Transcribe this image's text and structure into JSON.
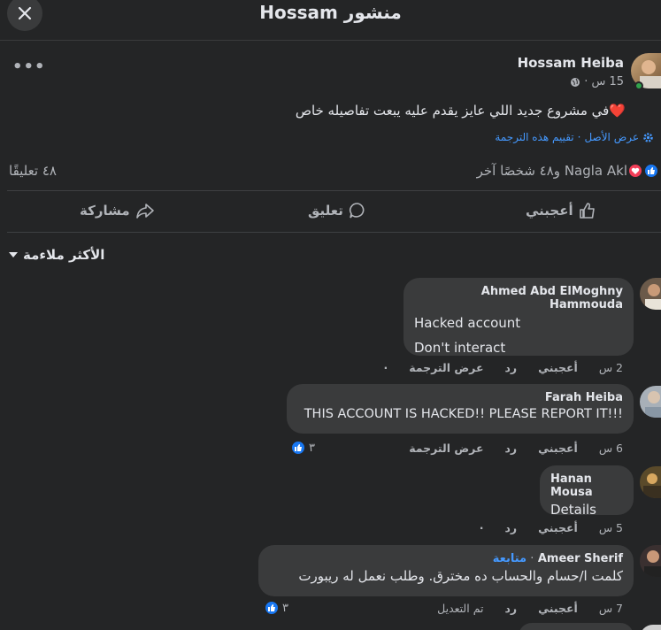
{
  "header": {
    "title": "منشور Hossam"
  },
  "post": {
    "author": "Hossam Heiba",
    "time": "15 س",
    "text": "في مشروع جديد اللي عايز يقدم عليه يبعت تفاصيله خاص",
    "translation": {
      "see_original": "عرض الأصل",
      "rate": "تقييم هذه الترجمة"
    },
    "reactions_text": "Nagla Akl و٤٨ شخصًا آخر",
    "comment_count": "٤٨ تعليقًا"
  },
  "actions": {
    "like": "أعجبني",
    "comment": "تعليق",
    "share": "مشاركة"
  },
  "sort_label": "الأكثر ملاءمة",
  "comments": [
    {
      "name": "Ahmed Abd ElMoghny Hammouda",
      "lines": [
        "Hacked account",
        "Don't interact"
      ],
      "time": "2 س",
      "like": "أعجبني",
      "reply": "رد",
      "translate": "عرض الترجمة",
      "dot": "·"
    },
    {
      "name": "Farah Heiba",
      "lines": [
        "THIS ACCOUNT IS HACKED!! PLEASE REPORT IT!!!"
      ],
      "time": "6 س",
      "like": "أعجبني",
      "reply": "رد",
      "translate": "عرض الترجمة",
      "reactions": "٣"
    },
    {
      "name": "Hanan Mousa",
      "lines": [
        "Details"
      ],
      "time": "5 س",
      "like": "أعجبني",
      "reply": "رد",
      "dot": "·"
    },
    {
      "name": "Ameer Sherif",
      "follow": "متابعة",
      "lines": [
        "كلمت ا/حسام والحساب ده مخترق. وطلب نعمل له ريبورت"
      ],
      "time": "7 س",
      "like": "أعجبني",
      "reply": "رد",
      "edited": "تم التعديل",
      "reactions": "٣"
    }
  ],
  "colors": {
    "background": "#242526",
    "bubble": "#3a3b3c",
    "link": "#4599ff",
    "like_blue": "#1877f2"
  }
}
